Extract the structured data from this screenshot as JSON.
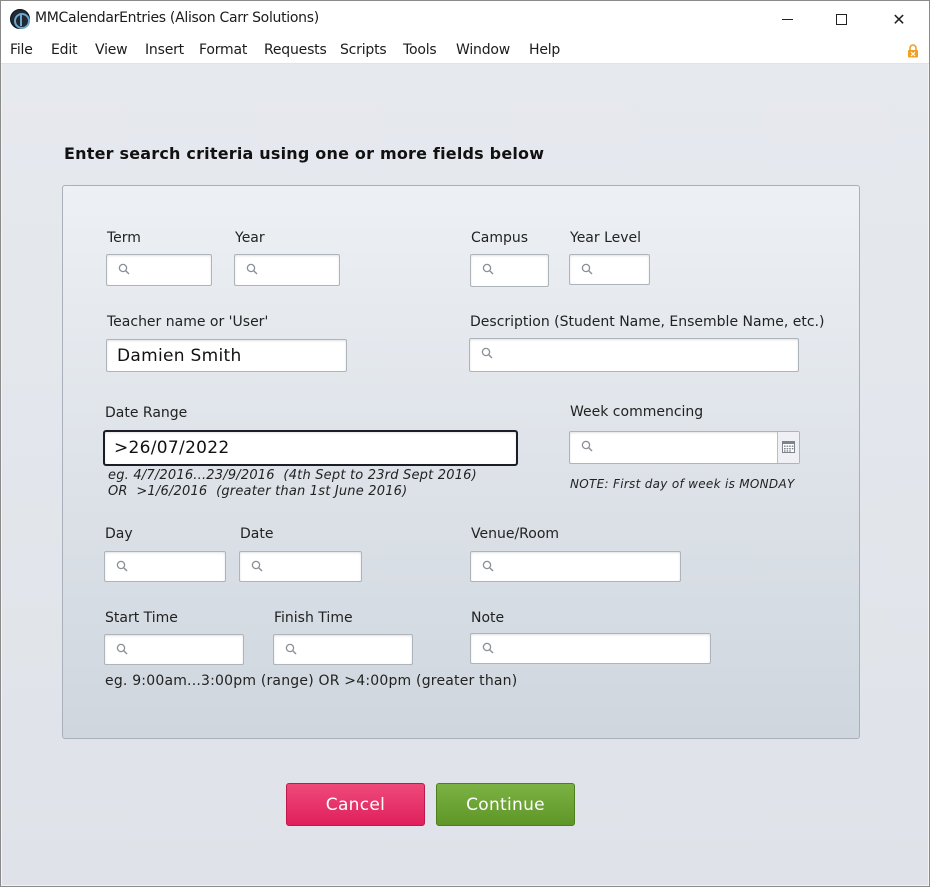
{
  "window": {
    "title": "MMCalendarEntries (Alison Carr Solutions)",
    "minimize_glyph": "",
    "maximize_glyph": "",
    "close_glyph": "✕"
  },
  "menu": [
    "File",
    "Edit",
    "View",
    "Insert",
    "Format",
    "Requests",
    "Scripts",
    "Tools",
    "Window",
    "Help"
  ],
  "form": {
    "heading": "Enter search criteria using one or more fields below",
    "labels": {
      "term": "Term",
      "year": "Year",
      "campus": "Campus",
      "year_level": "Year Level",
      "teacher": "Teacher name or 'User'",
      "description": "Description (Student Name, Ensemble Name, etc.)",
      "date_range": "Date Range",
      "week_commencing": "Week commencing",
      "day": "Day",
      "date": "Date",
      "venue": "Venue/Room",
      "start_time": "Start Time",
      "finish_time": "Finish Time",
      "note": "Note"
    },
    "values": {
      "teacher": "Damien Smith",
      "date_range": ">26/07/2022"
    },
    "hints": {
      "date_range_line1": "eg. 4/7/2016...23/9/2016  (4th Sept to 23rd Sept 2016)",
      "date_range_line2": "OR  >1/6/2016  (greater than 1st June 2016)",
      "week_note": "NOTE: First day of week is MONDAY",
      "time": "eg. 9:00am...3:00pm (range) OR >4:00pm (greater than)"
    }
  },
  "buttons": {
    "cancel": "Cancel",
    "continue": "Continue"
  },
  "colors": {
    "cancel": "#e42a63",
    "continue": "#6aa232",
    "lock": "#f0a020"
  },
  "icons": {
    "search": "magnifier-icon",
    "calendar": "calendar-icon",
    "lock": "lock-icon"
  }
}
